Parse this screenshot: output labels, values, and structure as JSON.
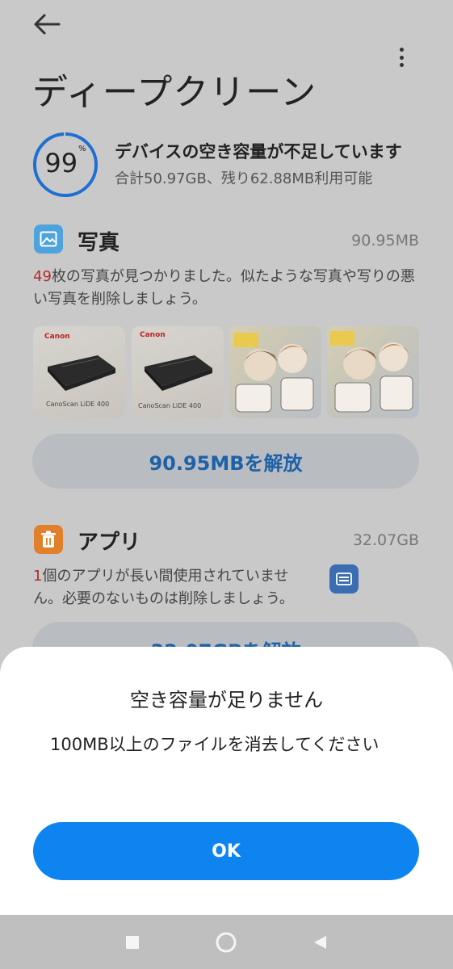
{
  "header": {
    "title": "ディープクリーン",
    "back_icon": "arrow-left-icon",
    "more_icon": "more-vertical-icon"
  },
  "storage": {
    "percent": "99",
    "percent_sign": "%",
    "percent_value": 99,
    "warning": "デバイスの空き容量が不足しています",
    "detail": "合計50.97GB、残り62.88MB利用可能",
    "ring_color": "#1f6fd0"
  },
  "photos": {
    "icon": "image-icon",
    "title": "写真",
    "size": "90.95MB",
    "count": "49",
    "desc_rest": "枚の写真が見つかりました。似たような写真や写りの悪い写真を削除しましょう。",
    "thumbs": [
      {
        "kind": "scanner",
        "brand": "Canon",
        "caption": "CanoScan LiDE 400"
      },
      {
        "kind": "scanner",
        "brand": "Canon",
        "caption": "CanoScan LiDE 400"
      },
      {
        "kind": "manga"
      },
      {
        "kind": "manga"
      }
    ],
    "release_label": "90.95MBを解放"
  },
  "apps": {
    "icon": "trash-icon",
    "title": "アプリ",
    "size": "32.07GB",
    "count": "1",
    "desc_rest": "個のアプリが長い間使用されていません。必要のないものは削除しましょう。",
    "app_icon": "app-icon",
    "release_label": "32.07GBを解放"
  },
  "dialog": {
    "title": "空き容量が足りません",
    "message": "100MB以上のファイルを消去してください",
    "ok_label": "OK"
  },
  "navbar": {
    "recents_icon": "square-icon",
    "home_icon": "circle-icon",
    "back_icon": "triangle-back-icon"
  },
  "colors": {
    "accent": "#0d84f0",
    "photo_icon": "#4fa3dc",
    "trash_icon": "#e0802a",
    "release_text": "#1d62a8",
    "count_red": "#b52a2a"
  }
}
